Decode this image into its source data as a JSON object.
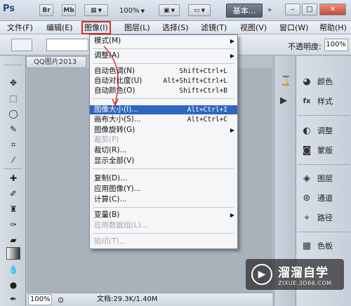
{
  "appbar": {
    "logo": "Ps",
    "bridge_label": "Br",
    "minibridge_label": "Mb",
    "zoom": "100%",
    "workspace": "基本...",
    "chevron": "»",
    "win_min": "–",
    "win_max": "□",
    "win_close": "✕"
  },
  "menubar": {
    "items": [
      "文件(F)",
      "编辑(E)",
      "图像(I)",
      "图层(L)",
      "选择(S)",
      "滤镜(T)",
      "视图(V)",
      "窗口(W)",
      "帮助(H)"
    ]
  },
  "options": {
    "opacity_label": "不透明度:",
    "opacity_value": "100%"
  },
  "document": {
    "tab_title": "QQ图片2013"
  },
  "status": {
    "zoom": "100%",
    "doc_info": "文档:29.3K/1.40M"
  },
  "dropdown": {
    "items": [
      {
        "label": "模式(M)",
        "shortcut": "",
        "submenu": true,
        "disabled": false
      },
      {
        "label": "调整(A)",
        "shortcut": "",
        "submenu": true,
        "disabled": false
      },
      {
        "label": "自动色调(N)",
        "shortcut": "Shift+Ctrl+L",
        "submenu": false,
        "disabled": false
      },
      {
        "label": "自动对比度(U)",
        "shortcut": "Alt+Shift+Ctrl+L",
        "submenu": false,
        "disabled": false
      },
      {
        "label": "自动颜色(O)",
        "shortcut": "Shift+Ctrl+B",
        "submenu": false,
        "disabled": false
      },
      {
        "label": "图像大小(I)...",
        "shortcut": "Alt+Ctrl+I",
        "submenu": false,
        "disabled": false,
        "highlighted": true
      },
      {
        "label": "画布大小(S)...",
        "shortcut": "Alt+Ctrl+C",
        "submenu": false,
        "disabled": false
      },
      {
        "label": "图像旋转(G)",
        "shortcut": "",
        "submenu": true,
        "disabled": false
      },
      {
        "label": "裁剪(P)",
        "shortcut": "",
        "submenu": false,
        "disabled": true
      },
      {
        "label": "裁切(R)...",
        "shortcut": "",
        "submenu": false,
        "disabled": false
      },
      {
        "label": "显示全部(V)",
        "shortcut": "",
        "submenu": false,
        "disabled": false
      },
      {
        "label": "复制(D)...",
        "shortcut": "",
        "submenu": false,
        "disabled": false
      },
      {
        "label": "应用图像(Y)...",
        "shortcut": "",
        "submenu": false,
        "disabled": false
      },
      {
        "label": "计算(C)...",
        "shortcut": "",
        "submenu": false,
        "disabled": false
      },
      {
        "label": "变量(B)",
        "shortcut": "",
        "submenu": true,
        "disabled": false
      },
      {
        "label": "应用数据组(L)...",
        "shortcut": "",
        "submenu": false,
        "disabled": true
      },
      {
        "label": "陷印(T)...",
        "shortcut": "",
        "submenu": false,
        "disabled": true
      }
    ]
  },
  "dock": {
    "panels": [
      {
        "label": "颜色",
        "icon": "palette-icon",
        "glyph": "🎨"
      },
      {
        "label": "样式",
        "icon": "styles-icon",
        "glyph": "fx"
      },
      {
        "label": "调整",
        "icon": "adjustments-icon",
        "glyph": "◐"
      },
      {
        "label": "蒙版",
        "icon": "masks-icon",
        "glyph": "◙"
      },
      {
        "label": "图层",
        "icon": "layers-icon",
        "glyph": "◈"
      },
      {
        "label": "通道",
        "icon": "channels-icon",
        "glyph": "⊛"
      },
      {
        "label": "路径",
        "icon": "paths-icon",
        "glyph": "⌖"
      },
      {
        "label": "色板",
        "icon": "swatches-icon",
        "glyph": "▦"
      }
    ]
  },
  "watermark": {
    "title": "溜溜自学",
    "subtitle": "ZIXUE.3D66.COM"
  }
}
